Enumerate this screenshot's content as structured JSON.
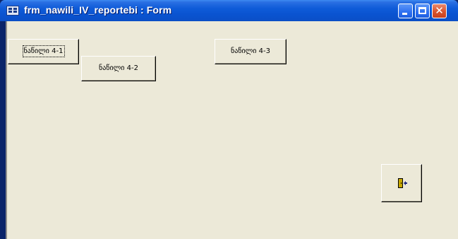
{
  "window": {
    "title": "frm_nawili_IV_reportebi : Form",
    "controls": {
      "minimize": "minimize-icon",
      "maximize": "maximize-icon",
      "close": "close-icon"
    }
  },
  "form": {
    "buttons": [
      {
        "label": "ნაწილი 4-1",
        "focused": true
      },
      {
        "label": "ნაწილი 4-2",
        "focused": false
      },
      {
        "label": "ნაწილი 4-3",
        "focused": false
      }
    ],
    "exit_button": {
      "icon": "exit-door-icon"
    }
  },
  "colors": {
    "titlebar": "#0a53d0",
    "form_background": "#ece9d8",
    "close_button": "#d9542e"
  }
}
